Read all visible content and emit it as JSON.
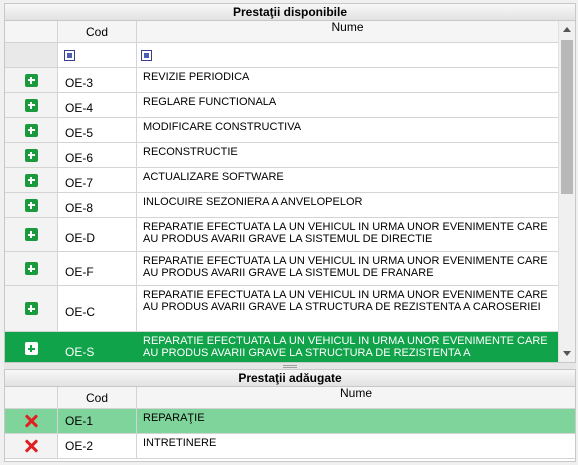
{
  "top_panel": {
    "title": "Prestaţii disponibile",
    "columns": {
      "code": "Cod",
      "name": "Nume"
    },
    "rows": [
      {
        "code": "OE-3",
        "name": "REVIZIE PERIODICA"
      },
      {
        "code": "OE-4",
        "name": "REGLARE FUNCTIONALA"
      },
      {
        "code": "OE-5",
        "name": "MODIFICARE CONSTRUCTIVA"
      },
      {
        "code": "OE-6",
        "name": "RECONSTRUCTIE"
      },
      {
        "code": "OE-7",
        "name": "ACTUALIZARE SOFTWARE"
      },
      {
        "code": "OE-8",
        "name": "INLOCUIRE SEZONIERA A ANVELOPELOR"
      },
      {
        "code": "OE-D",
        "name": "REPARATIE EFECTUATA LA UN VEHICUL IN URMA UNOR EVENIMENTE CARE AU PRODUS AVARII GRAVE LA SISTEMUL DE DIRECTIE"
      },
      {
        "code": "OE-F",
        "name": "REPARATIE EFECTUATA LA UN VEHICUL IN URMA UNOR EVENIMENTE CARE AU PRODUS AVARII GRAVE LA SISTEMUL DE FRANARE"
      },
      {
        "code": "OE-C",
        "name": "REPARATIE EFECTUATA LA UN VEHICUL IN URMA UNOR EVENIMENTE CARE AU PRODUS AVARII GRAVE LA STRUCTURA DE REZISTENTA A CAROSERIEI"
      },
      {
        "code": "OE-S",
        "name": "REPARATIE EFECTUATA LA UN VEHICUL IN URMA UNOR EVENIMENTE CARE AU PRODUS AVARII GRAVE LA STRUCTURA DE REZISTENTA A"
      }
    ],
    "selected_index": 9,
    "row_icon": "plus-icon"
  },
  "bottom_panel": {
    "title": "Prestaţii adăugate",
    "columns": {
      "code": "Cod",
      "name": "Nume"
    },
    "rows": [
      {
        "code": "OE-1",
        "name": "REPARAŢIE"
      },
      {
        "code": "OE-2",
        "name": "INTRETINERE"
      }
    ],
    "selected_index": 0,
    "row_icon": "remove-icon"
  },
  "colors": {
    "accent_green": "#11a34a",
    "selected_light_green": "#7fd49c",
    "remove_red": "#e01f1f"
  }
}
